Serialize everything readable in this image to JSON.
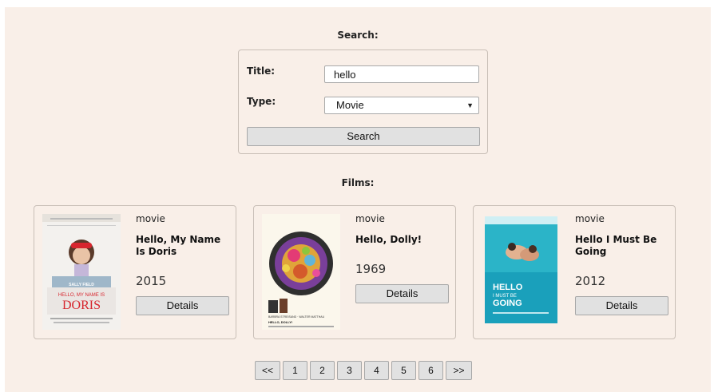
{
  "search": {
    "heading": "Search:",
    "title_label": "Title:",
    "title_value": "hello",
    "type_label": "Type:",
    "type_value": "Movie",
    "button_label": "Search"
  },
  "films": {
    "heading": "Films:",
    "items": [
      {
        "type": "movie",
        "title": "Hello, My Name Is Doris",
        "year": "2015",
        "details_label": "Details",
        "poster": {
          "credit": "SALLY FIELD",
          "tagline": "HELLO, MY NAME IS",
          "name": "DORIS"
        }
      },
      {
        "type": "movie",
        "title": "Hello, Dolly!",
        "year": "1969",
        "details_label": "Details",
        "poster": {
          "credit": "BARBRA STREISAND · WALTER MATTHAU",
          "name": "HELLO, DOLLY!"
        }
      },
      {
        "type": "movie",
        "title": "Hello I Must Be Going",
        "year": "2012",
        "details_label": "Details",
        "poster": {
          "name_line1": "HELLO",
          "name_line2": "I MUST BE",
          "name_line3": "GOING"
        }
      }
    ]
  },
  "pagination": {
    "prev": "<<",
    "pages": [
      "1",
      "2",
      "3",
      "4",
      "5",
      "6"
    ],
    "next": ">>"
  },
  "colors": {
    "page_background": "#f9efe8",
    "button_background": "#e1e1e1"
  }
}
